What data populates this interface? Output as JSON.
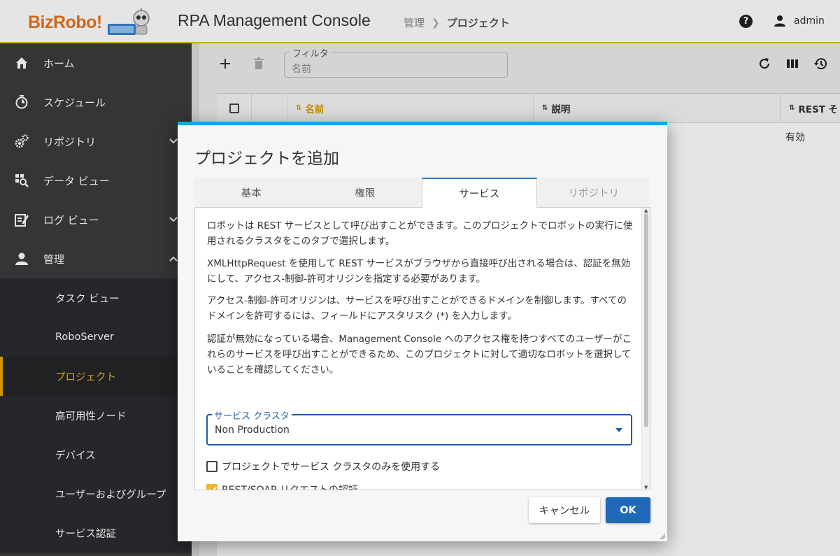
{
  "header": {
    "logo": "BizRobo!",
    "app_title": "RPA Management Console",
    "breadcrumb": [
      "管理",
      "プロジェクト"
    ],
    "user": "admin"
  },
  "sidebar": {
    "items": [
      {
        "label": "ホーム",
        "icon": "home-icon"
      },
      {
        "label": "スケジュール",
        "icon": "timer-icon"
      },
      {
        "label": "リポジトリ",
        "icon": "gears-icon"
      },
      {
        "label": "データ ビュー",
        "icon": "data-view-icon"
      },
      {
        "label": "ログ ビュー",
        "icon": "log-edit-icon"
      },
      {
        "label": "管理",
        "icon": "person-icon"
      }
    ],
    "sub_items": [
      "タスク ビュー",
      "RoboServer",
      "プロジェクト",
      "高可用性ノード",
      "デバイス",
      "ユーザーおよびグループ",
      "サービス認証"
    ]
  },
  "main": {
    "filter": {
      "legend": "フィルタ",
      "placeholder": "名前"
    },
    "columns": [
      "名前",
      "説明",
      "REST そ"
    ],
    "row_value": "有効"
  },
  "dialog": {
    "title": "プロジェクトを追加",
    "tabs": [
      "基本",
      "権限",
      "サービス",
      "リポジトリ"
    ],
    "paragraphs": [
      "ロボットは REST サービスとして呼び出すことができます。このプロジェクトでロボットの実行に使用されるクラスタをこのタブで選択します。",
      "XMLHttpRequest を使用して REST サービスがブラウザから直接呼び出される場合は、認証を無効にして、アクセス-制御-許可オリジンを指定する必要があります。",
      "アクセス-制御-許可オリジンは、サービスを呼び出すことができるドメインを制御します。すべてのドメインを許可するには、フィールドにアスタリスク (*) を入力します。",
      "認証が無効になっている場合、Management Console へのアクセス権を持つすべてのユーザーがこれらのサービスを呼び出すことができるため、このプロジェクトに対して適切なロボットを選択していることを確認してください。"
    ],
    "cluster_select": {
      "legend": "サービス クラスタ",
      "value": "Non Production"
    },
    "checkbox1": "プロジェクトでサービス クラスタのみを使用する",
    "checkbox2": "REST/SOAP リクエストの認証",
    "cancel": "キャンセル",
    "ok": "OK"
  },
  "colors": {
    "accent": "#f0b429",
    "primary": "#2068b8",
    "dialog_top": "#1ca1e6",
    "sidebar": "#3a3b3e"
  }
}
